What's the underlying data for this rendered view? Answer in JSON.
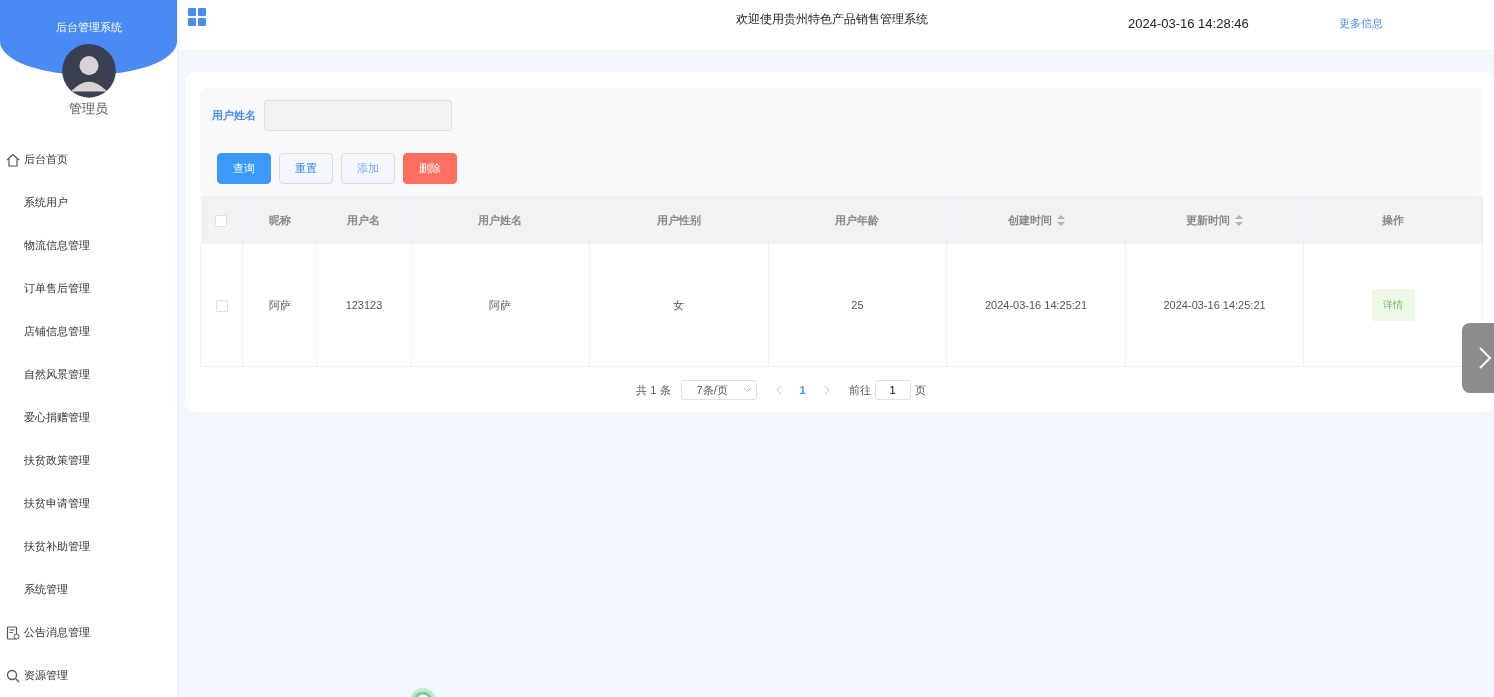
{
  "sidebar": {
    "title": "后台管理系统",
    "user": "管理员",
    "items": [
      {
        "label": "后台首页",
        "kind": "home",
        "selected": false
      },
      {
        "label": "系统用户",
        "selected": false
      },
      {
        "label": "物流信息管理",
        "selected": false
      },
      {
        "label": "订单售后管理",
        "selected": false
      },
      {
        "label": "店铺信息管理",
        "selected": false
      },
      {
        "label": "自然风景管理",
        "selected": false
      },
      {
        "label": "爱心捐赠管理",
        "selected": false
      },
      {
        "label": "扶贫政策管理",
        "selected": false
      },
      {
        "label": "扶贫申请管理",
        "selected": false
      },
      {
        "label": "扶贫补助管理",
        "selected": false
      },
      {
        "label": "系统管理",
        "selected": false
      },
      {
        "label": "公告消息管理",
        "kind": "notice",
        "selected": false
      },
      {
        "label": "资源管理",
        "kind": "search",
        "selected": false
      }
    ]
  },
  "header": {
    "title": "欢迎使用贵州特色产品销售管理系统",
    "datetime": "2024-03-16 14:28:46",
    "more": "更多信息"
  },
  "search": {
    "label": "用户姓名"
  },
  "buttons": [
    {
      "label": "查询",
      "kind": "primary"
    },
    {
      "label": "重置",
      "kind": "plain"
    },
    {
      "label": "添加",
      "kind": "light"
    },
    {
      "label": "删除",
      "kind": "danger"
    }
  ],
  "table": {
    "select_all": false,
    "columns": [
      {
        "label": "昵称",
        "sortable": false
      },
      {
        "label": "用户名",
        "sortable": false
      },
      {
        "label": "用户姓名",
        "sortable": false
      },
      {
        "label": "用户性别",
        "sortable": false
      },
      {
        "label": "用户年龄",
        "sortable": false
      },
      {
        "label": "创建时间",
        "sortable": true
      },
      {
        "label": "更新时间",
        "sortable": true
      },
      {
        "label": "操作",
        "sortable": false
      }
    ],
    "rows": [
      {
        "checked": false,
        "cells": [
          "阿萨",
          "123123",
          "阿萨",
          "女",
          "25",
          "2024-03-16 14:25:21",
          "2024-03-16 14:25:21"
        ],
        "action": "详情"
      }
    ]
  },
  "pagination": {
    "total": "共 1 条",
    "page_size": "7条/页",
    "pages": [
      {
        "label": "1",
        "selected": true
      }
    ],
    "goto_label": "前往",
    "goto_value": "1",
    "goto_suffix": "页"
  }
}
